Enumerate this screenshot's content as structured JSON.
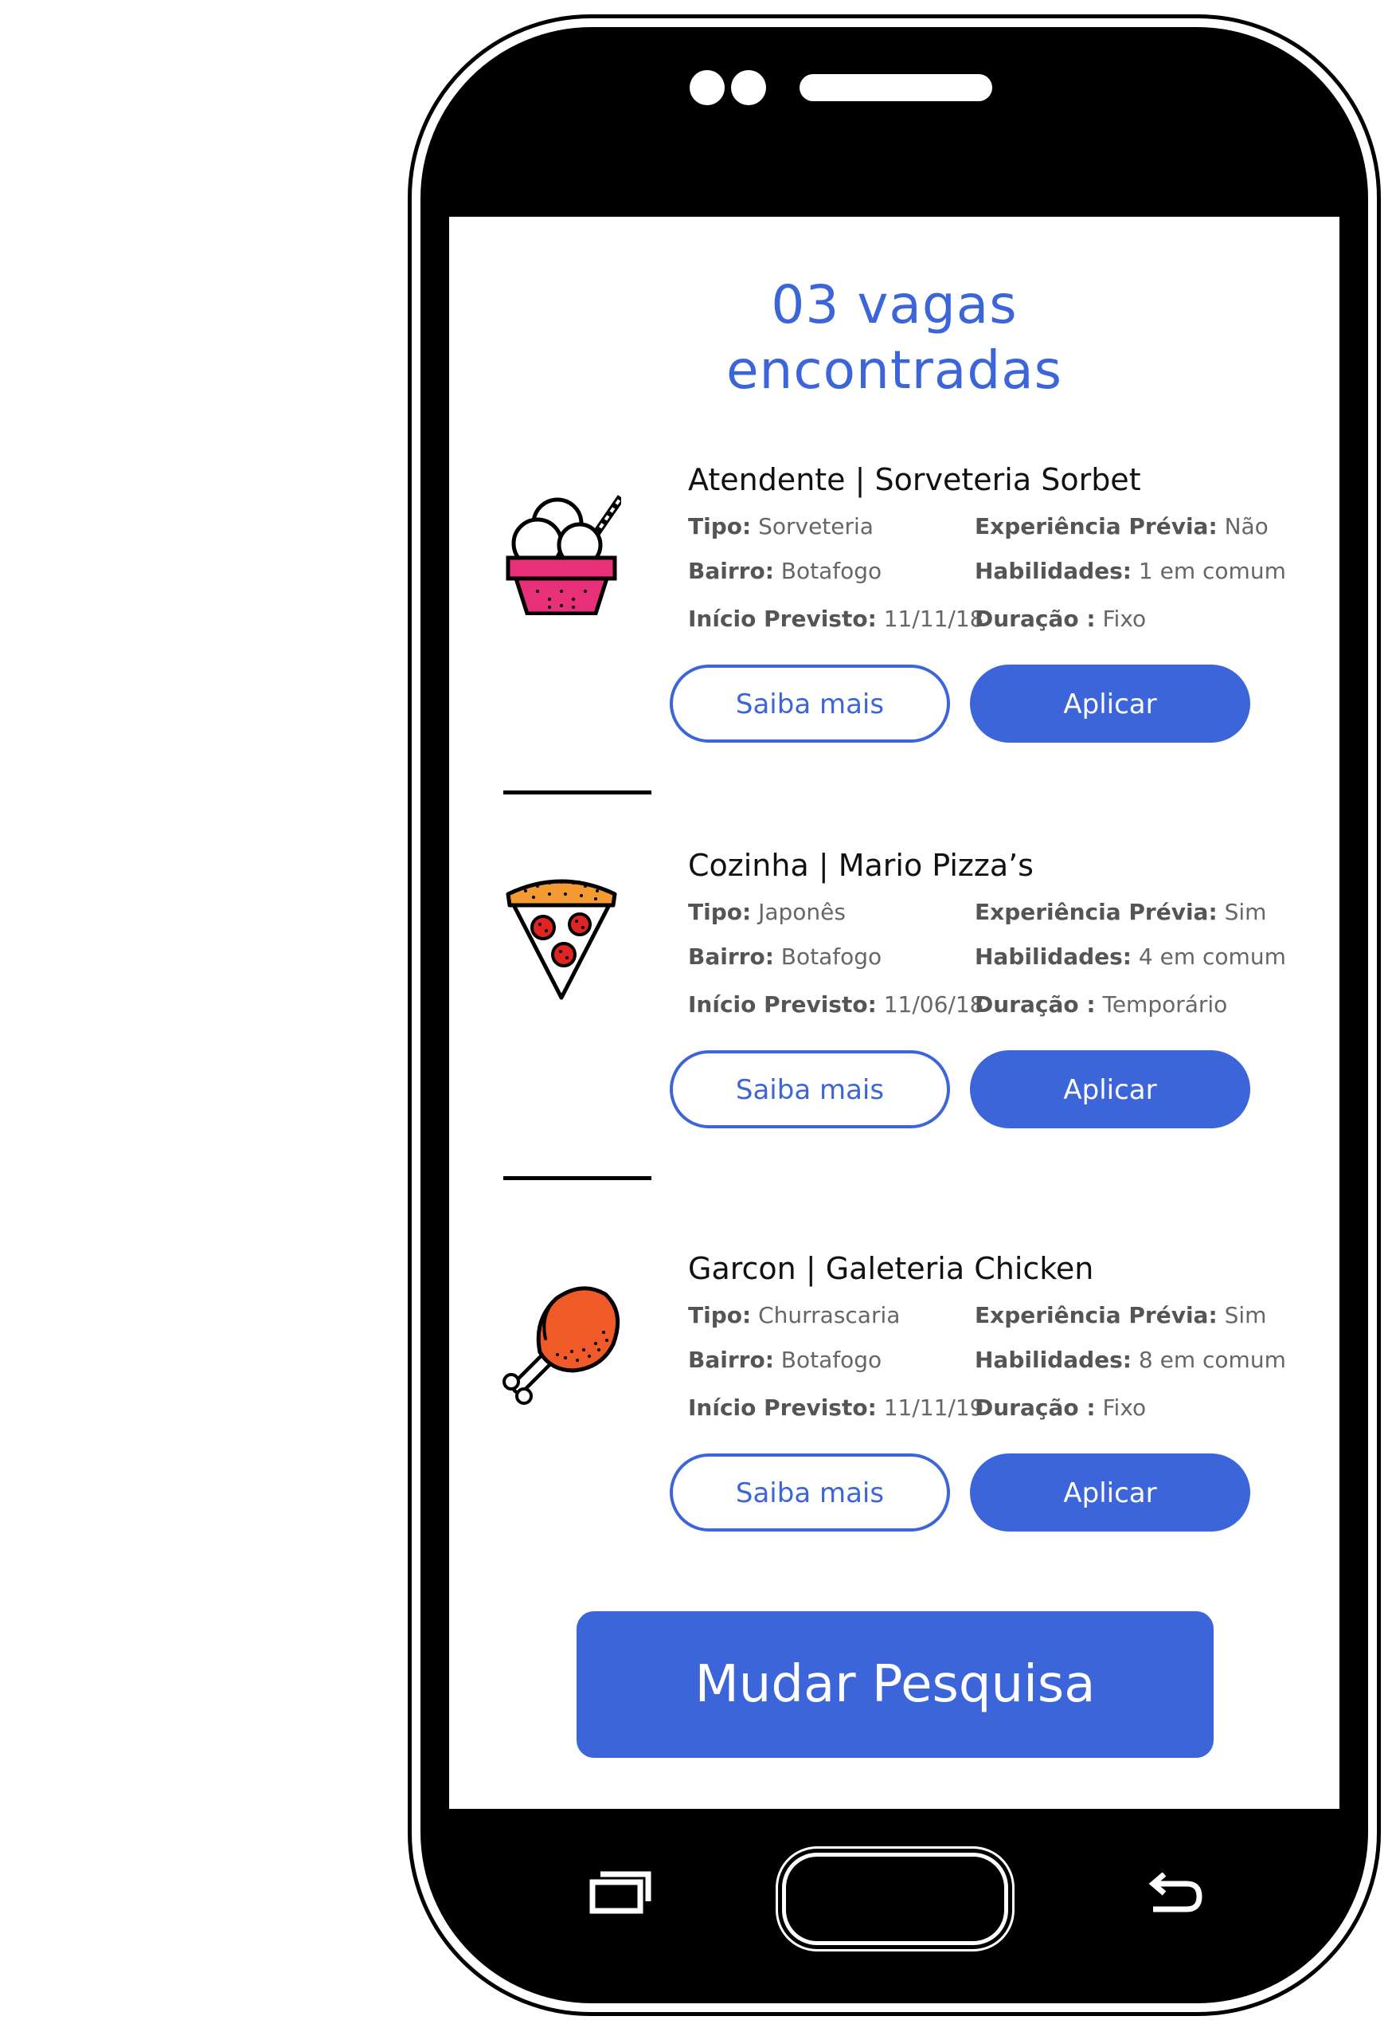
{
  "screen": {
    "title_line1": "03 vagas",
    "title_line2": "encontradas"
  },
  "labels": {
    "tipo": "Tipo:",
    "bairro": "Bairro:",
    "inicio": "Início Previsto:",
    "experiencia": "Experiência Prévia:",
    "habilidades": "Habilidades:",
    "duracao": "Duração :"
  },
  "jobs": [
    {
      "icon": "ice-cream-icon",
      "title": "Atendente | Sorveteria Sorbet",
      "tipo": "Sorveteria",
      "bairro": "Botafogo",
      "inicio": "11/11/18",
      "experiencia": "Não",
      "habilidades": "1 em comum",
      "duracao": "Fixo",
      "more_label": "Saiba mais",
      "apply_label": "Aplicar"
    },
    {
      "icon": "pizza-icon",
      "title": "Cozinha | Mario Pizza’s",
      "tipo": "Japonês",
      "bairro": "Botafogo",
      "inicio": "11/06/18",
      "experiencia": "Sim",
      "habilidades": "4 em comum",
      "duracao": "Temporário",
      "more_label": "Saiba mais",
      "apply_label": "Aplicar"
    },
    {
      "icon": "chicken-leg-icon",
      "title": "Garcon | Galeteria Chicken",
      "tipo": "Churrascaria",
      "bairro": "Botafogo",
      "inicio": "11/11/19",
      "experiencia": "Sim",
      "habilidades": "8 em comum",
      "duracao": "Fixo",
      "more_label": "Saiba mais",
      "apply_label": "Aplicar"
    }
  ],
  "footer": {
    "change_search_label": "Mudar Pesquisa"
  },
  "colors": {
    "accent": "#3c65d9",
    "ice_cream_cup": "#e8307a",
    "pizza_crust": "#f39a33",
    "pepperoni": "#e02424",
    "chicken": "#f05a28"
  }
}
